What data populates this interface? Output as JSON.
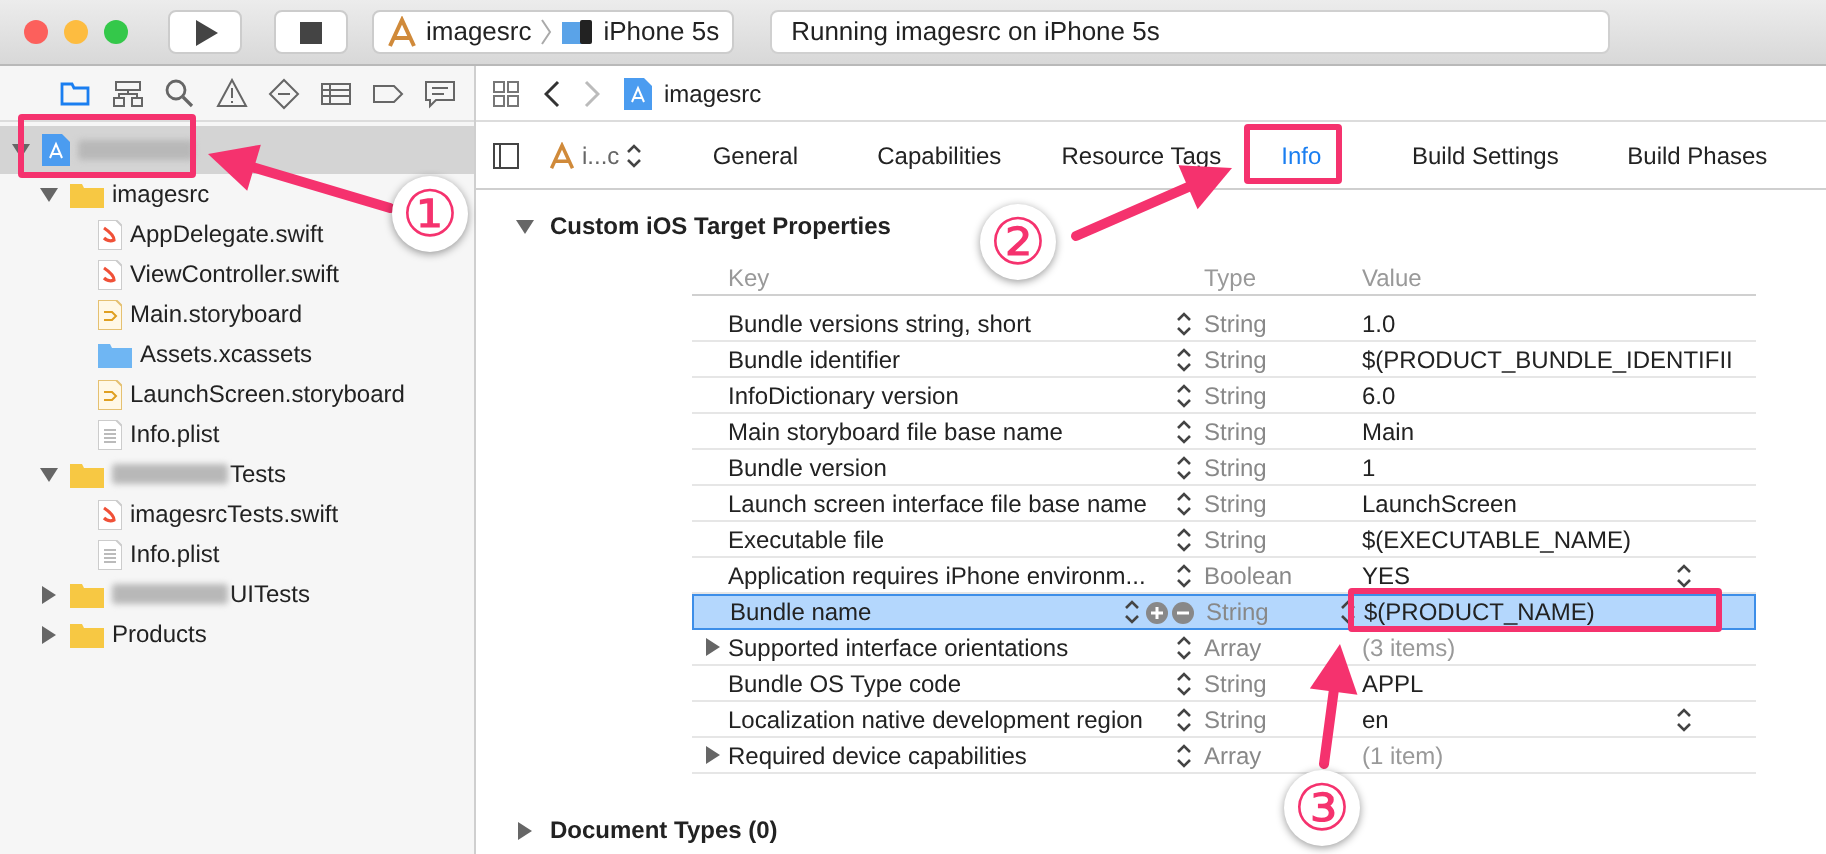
{
  "toolbar": {
    "scheme": "imagesrc",
    "device": "iPhone 5s",
    "status": "Running imagesrc on iPhone 5s"
  },
  "navigator": {
    "items": [
      {
        "kind": "project",
        "redacted": true,
        "selected": true,
        "expanded": true,
        "children": [
          {
            "label": "imagesrc",
            "kind": "folder",
            "expanded": true,
            "children": [
              {
                "label": "AppDelegate.swift",
                "kind": "swift"
              },
              {
                "label": "ViewController.swift",
                "kind": "swift"
              },
              {
                "label": "Main.storyboard",
                "kind": "storyboard"
              },
              {
                "label": "Assets.xcassets",
                "kind": "assets"
              },
              {
                "label": "LaunchScreen.storyboard",
                "kind": "storyboard"
              },
              {
                "label": "Info.plist",
                "kind": "plist"
              }
            ]
          },
          {
            "label": "Tests",
            "kind": "folder",
            "redacted": true,
            "expanded": true,
            "children": [
              {
                "label": "imagesrcTests.swift",
                "kind": "swift"
              },
              {
                "label": "Info.plist",
                "kind": "plist"
              }
            ]
          },
          {
            "label": "UITests",
            "kind": "folder",
            "redacted": true,
            "expanded": false
          },
          {
            "label": "Products",
            "kind": "folder",
            "expanded": false
          }
        ]
      }
    ]
  },
  "editor": {
    "breadcrumb": "imagesrc",
    "target": "i...c",
    "tabs": [
      {
        "label": "General",
        "selected": false
      },
      {
        "label": "Capabilities",
        "selected": false
      },
      {
        "label": "Resource Tags",
        "selected": false
      },
      {
        "label": "Info",
        "selected": true
      },
      {
        "label": "Build Settings",
        "selected": false
      },
      {
        "label": "Build Phases",
        "selected": false
      }
    ],
    "section": {
      "title": "Custom iOS Target Properties",
      "expanded": true
    },
    "columns": [
      "Key",
      "Type",
      "Value"
    ],
    "rows": [
      {
        "key": "Bundle versions string, short",
        "type": "String",
        "value": "1.0",
        "selected": false
      },
      {
        "key": "Bundle identifier",
        "type": "String",
        "value": "$(PRODUCT_BUNDLE_IDENTIFII",
        "selected": false
      },
      {
        "key": "InfoDictionary version",
        "type": "String",
        "value": "6.0",
        "selected": false
      },
      {
        "key": "Main storyboard file base name",
        "type": "String",
        "value": "Main",
        "selected": false
      },
      {
        "key": "Bundle version",
        "type": "String",
        "value": "1",
        "selected": false
      },
      {
        "key": "Launch screen interface file base name",
        "type": "String",
        "value": "LaunchScreen",
        "selected": false
      },
      {
        "key": "Executable file",
        "type": "String",
        "value": "$(EXECUTABLE_NAME)",
        "selected": false
      },
      {
        "key": "Application requires iPhone environm...",
        "type": "Boolean",
        "value": "YES",
        "kind": "popup",
        "selected": false
      },
      {
        "key": "Bundle name",
        "type": "String",
        "value": "$(PRODUCT_NAME)",
        "selected": true
      },
      {
        "key": "Supported interface orientations",
        "type": "Array",
        "value": "(3 items)",
        "kind": "collection",
        "expanded": false,
        "selected": false
      },
      {
        "key": "Bundle OS Type code",
        "type": "String",
        "value": "APPL",
        "selected": false
      },
      {
        "key": "Localization native development region",
        "type": "String",
        "value": "en",
        "kind": "popup",
        "selected": false
      },
      {
        "key": "Required device capabilities",
        "type": "Array",
        "value": "(1 item)",
        "kind": "collection",
        "expanded": false,
        "selected": false
      }
    ],
    "section2": {
      "title": "Document Types (0)",
      "expanded": false
    }
  },
  "annotations": [
    "①",
    "②",
    "③"
  ]
}
